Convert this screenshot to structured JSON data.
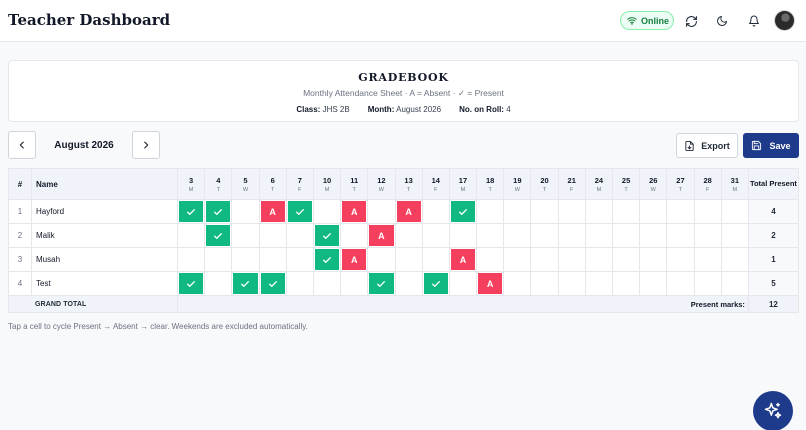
{
  "header": {
    "title": "Teacher Dashboard",
    "status": "Online"
  },
  "gradebook": {
    "title": "GRADEBOOK",
    "subtitle": "Monthly Attendance Sheet · A = Absent · ✓ = Present",
    "class_label": "Class:",
    "class_value": "JHS 2B",
    "month_label": "Month:",
    "month_value": "August 2026",
    "roll_label": "No. on Roll:",
    "roll_value": "4"
  },
  "toolbar": {
    "current_month": "August 2026",
    "export_label": "Export",
    "save_label": "Save"
  },
  "table": {
    "col_index": "#",
    "col_name": "Name",
    "col_total": "Total Present",
    "days": [
      {
        "num": "3",
        "wd": "M"
      },
      {
        "num": "4",
        "wd": "T"
      },
      {
        "num": "5",
        "wd": "W"
      },
      {
        "num": "6",
        "wd": "T"
      },
      {
        "num": "7",
        "wd": "F"
      },
      {
        "num": "10",
        "wd": "M"
      },
      {
        "num": "11",
        "wd": "T"
      },
      {
        "num": "12",
        "wd": "W"
      },
      {
        "num": "13",
        "wd": "T"
      },
      {
        "num": "14",
        "wd": "F"
      },
      {
        "num": "17",
        "wd": "M"
      },
      {
        "num": "18",
        "wd": "T"
      },
      {
        "num": "19",
        "wd": "W"
      },
      {
        "num": "20",
        "wd": "T"
      },
      {
        "num": "21",
        "wd": "F"
      },
      {
        "num": "24",
        "wd": "M"
      },
      {
        "num": "25",
        "wd": "T"
      },
      {
        "num": "26",
        "wd": "W"
      },
      {
        "num": "27",
        "wd": "T"
      },
      {
        "num": "28",
        "wd": "F"
      },
      {
        "num": "31",
        "wd": "M"
      }
    ],
    "rows": [
      {
        "index": "1",
        "name": "Hayford",
        "marks": [
          "P",
          "P",
          "",
          "A",
          "P",
          "",
          "A",
          "",
          "A",
          "",
          "P",
          "",
          "",
          "",
          "",
          "",
          "",
          "",
          "",
          "",
          ""
        ],
        "total": "4"
      },
      {
        "index": "2",
        "name": "Malik",
        "marks": [
          "",
          "P",
          "",
          "",
          "",
          "P",
          "",
          "A",
          "",
          "",
          "",
          "",
          "",
          "",
          "",
          "",
          "",
          "",
          "",
          "",
          ""
        ],
        "total": "2"
      },
      {
        "index": "3",
        "name": "Musah",
        "marks": [
          "",
          "",
          "",
          "",
          "",
          "P",
          "A",
          "",
          "",
          "",
          "A",
          "",
          "",
          "",
          "",
          "",
          "",
          "",
          "",
          "",
          ""
        ],
        "total": "1"
      },
      {
        "index": "4",
        "name": "Test",
        "marks": [
          "P",
          "",
          "P",
          "P",
          "",
          "",
          "",
          "P",
          "",
          "P",
          "",
          "A",
          "",
          "",
          "",
          "",
          "",
          "",
          "",
          "",
          ""
        ],
        "total": "5"
      }
    ],
    "absent_label": "A",
    "grand_total_label": "GRAND TOTAL",
    "present_marks_label": "Present marks:",
    "grand_total_value": "12"
  },
  "footnote": "Tap a cell to cycle Present → Absent → clear. Weekends are excluded automatically.",
  "colors": {
    "present": "#10b981",
    "absent": "#f43f5e",
    "primary": "#1e3a8a",
    "online": "#15803d"
  },
  "icons": [
    "wifi-icon",
    "refresh-icon",
    "moon-icon",
    "bell-icon",
    "chevron-left-icon",
    "chevron-right-icon",
    "export-file-icon",
    "save-icon",
    "check-icon",
    "sparkles-icon"
  ]
}
